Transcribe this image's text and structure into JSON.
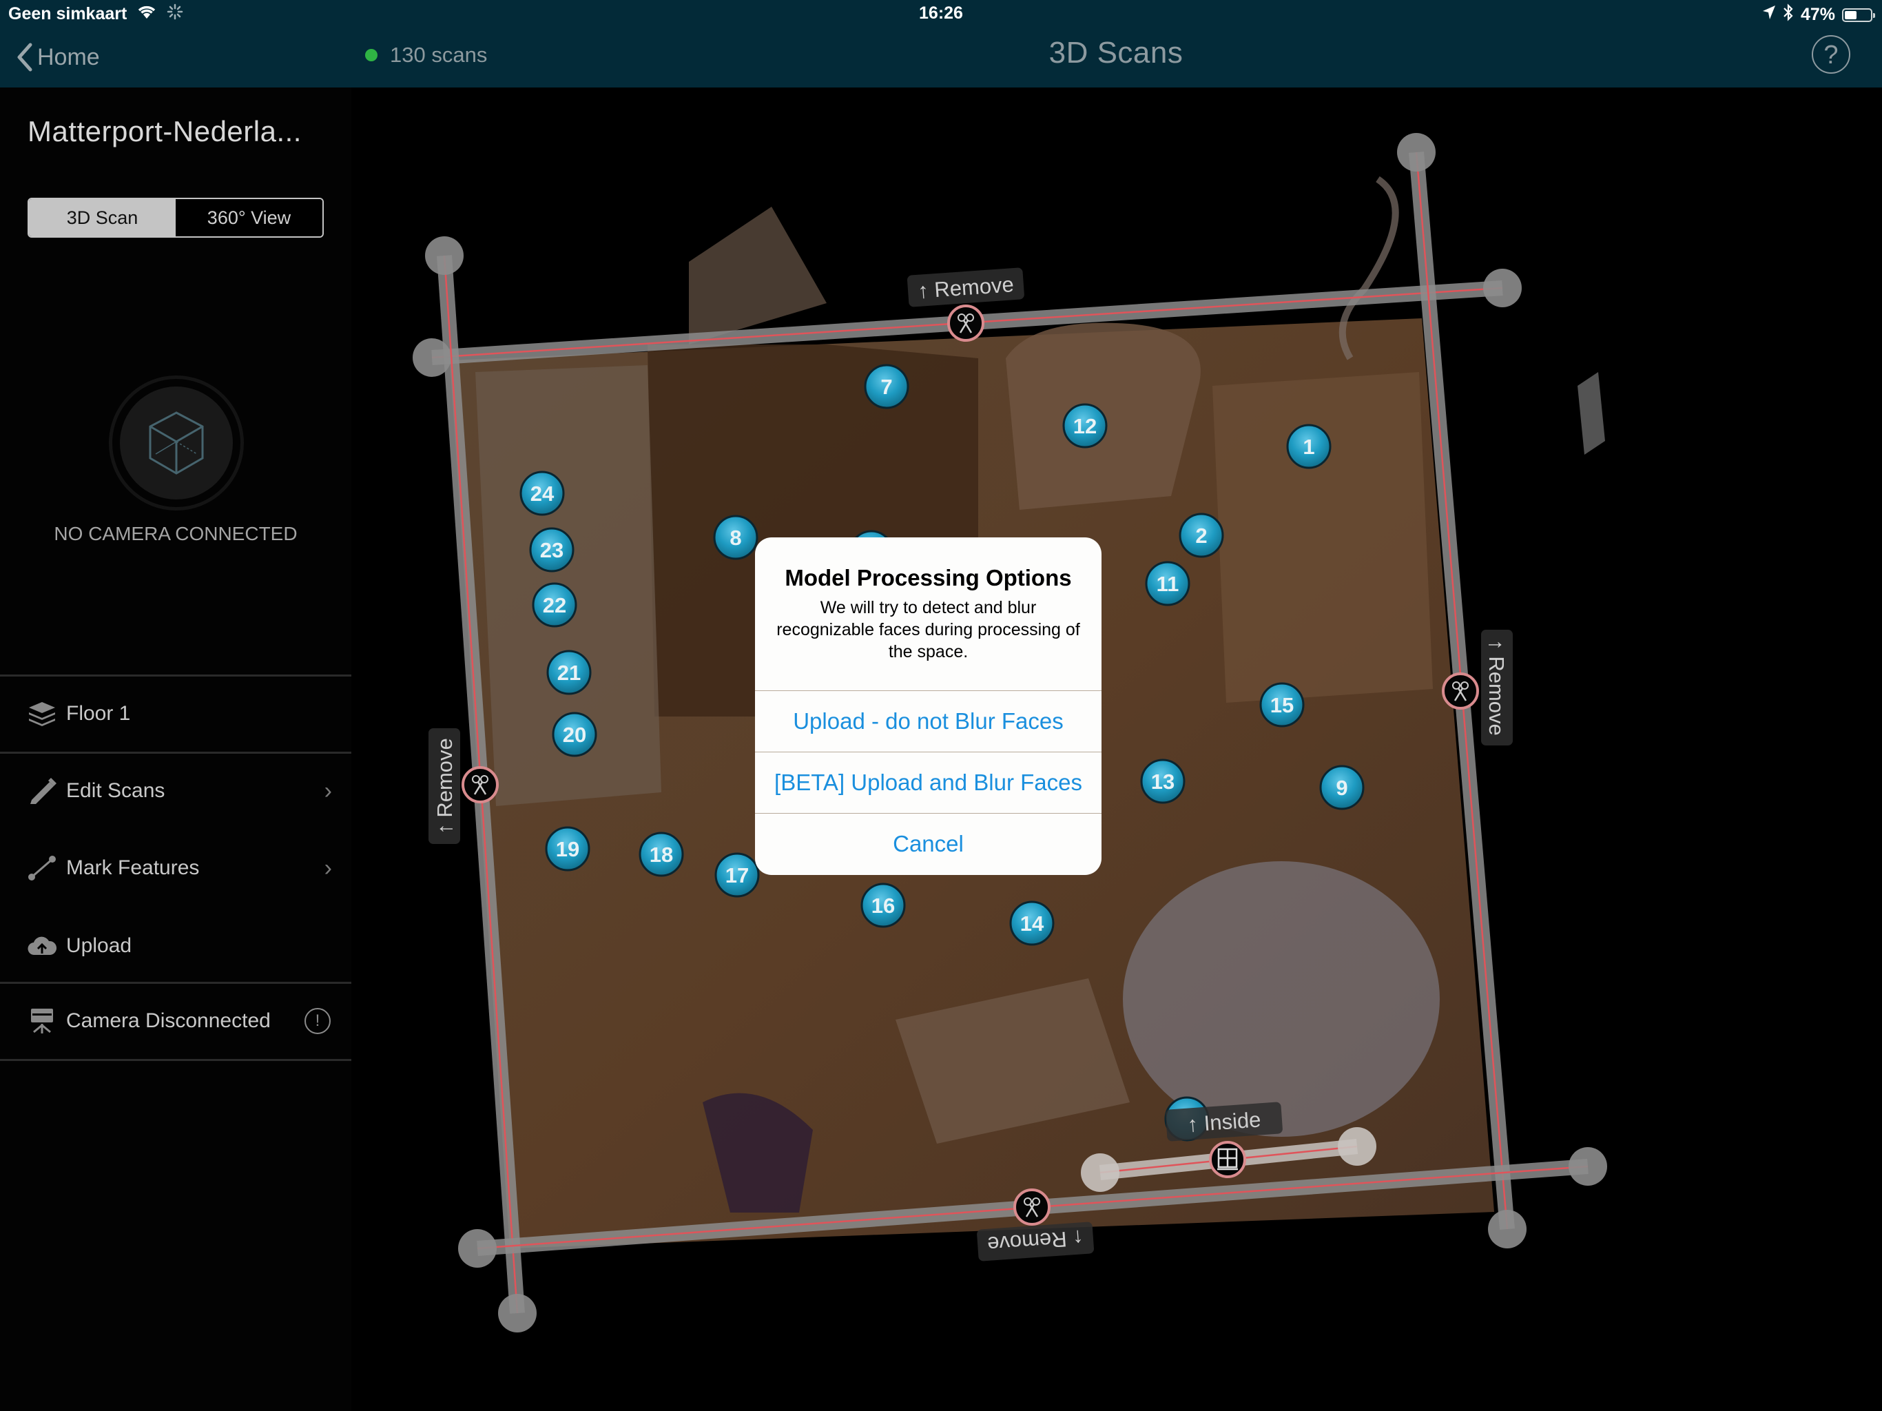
{
  "status_bar": {
    "carrier": "Geen simkaart",
    "time": "16:26",
    "battery_percent": "47%",
    "battery_level": 0.47,
    "icons": [
      "wifi-icon",
      "activity-spinner-icon",
      "location-arrow-icon",
      "bluetooth-icon",
      "battery-icon"
    ]
  },
  "nav": {
    "back_label": "Home",
    "scan_count": "130 scans",
    "scan_status_color": "#2fb344",
    "title": "3D Scans",
    "help_label": "?"
  },
  "sidebar": {
    "project_title": "Matterport-Nederla...",
    "segments": [
      {
        "label": "3D Scan",
        "active": true
      },
      {
        "label": "360° View",
        "active": false
      }
    ],
    "camera_status": "NO CAMERA CONNECTED",
    "menu": [
      {
        "label": "Floor 1",
        "icon": "layers-icon",
        "chevron": false
      },
      {
        "label": "Edit Scans",
        "icon": "pencil-icon",
        "chevron": true
      },
      {
        "label": "Mark Features",
        "icon": "measure-line-icon",
        "chevron": true
      },
      {
        "label": "Upload",
        "icon": "cloud-upload-icon",
        "chevron": false
      },
      {
        "label": "Camera Disconnected",
        "icon": "camera-tripod-icon",
        "alert": "!"
      }
    ]
  },
  "map": {
    "scan_markers": [
      "1",
      "2",
      "7",
      "8",
      "9",
      "11",
      "12",
      "13",
      "14",
      "15",
      "16",
      "17",
      "18",
      "19",
      "20",
      "21",
      "22",
      "23",
      "24"
    ],
    "wall_labels": {
      "top": "Remove",
      "left": "Remove",
      "right": "Remove",
      "bottom": "Remove",
      "window": "Inside"
    },
    "marker_color": "#1e9bc2",
    "wall_line_color": "#e0545a"
  },
  "dialog": {
    "title": "Model Processing Options",
    "message": "We will try to detect and blur recognizable faces during processing of the space.",
    "buttons": [
      {
        "label": "Upload - do not Blur Faces"
      },
      {
        "label": "[BETA] Upload and Blur Faces"
      },
      {
        "label": "Cancel"
      }
    ],
    "button_color": "#1a8fde"
  }
}
